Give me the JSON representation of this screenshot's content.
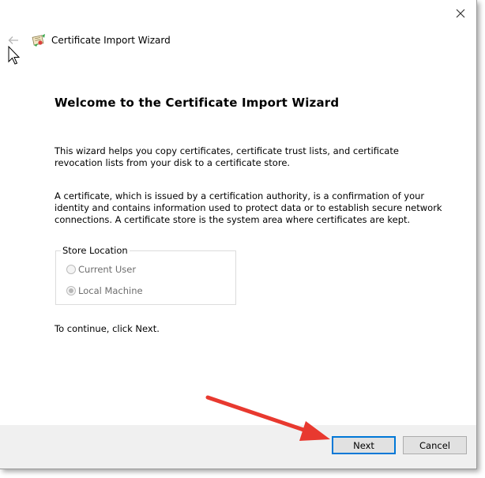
{
  "window": {
    "title": "Certificate Import Wizard"
  },
  "main": {
    "heading": "Welcome to the Certificate Import Wizard",
    "paragraph1": "This wizard helps you copy certificates, certificate trust lists, and certificate revocation lists from your disk to a certificate store.",
    "paragraph2": "A certificate, which is issued by a certification authority, is a confirmation of your identity and contains information used to protect data or to establish secure network connections. A certificate store is the system area where certificates are kept.",
    "store_location": {
      "legend": "Store Location",
      "options": [
        {
          "label": "Current User",
          "checked": false,
          "enabled": false
        },
        {
          "label": "Local Machine",
          "checked": true,
          "enabled": false
        }
      ]
    },
    "continue_text": "To continue, click Next."
  },
  "footer": {
    "next_label": "Next",
    "cancel_label": "Cancel"
  },
  "colors": {
    "accent": "#0078d7",
    "annotation_arrow": "#e8392f"
  },
  "icons": [
    "close-icon",
    "back-arrow-icon",
    "certificate-icon",
    "mouse-cursor-icon"
  ]
}
